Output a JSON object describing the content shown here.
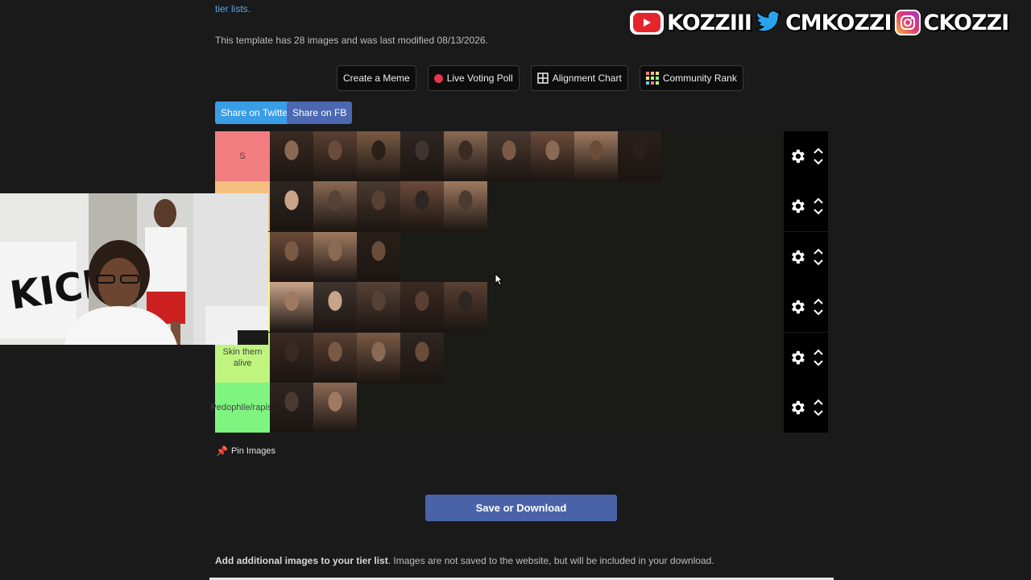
{
  "top": {
    "link": "tier lists.",
    "info": "This template has 28 images and was last modified 08/13/2026."
  },
  "social": {
    "youtube": "KOZZIII",
    "twitter": "CMKOZZI",
    "instagram": "CKOZZI"
  },
  "actions": {
    "create_meme": "Create a Meme",
    "live_poll": "Live Voting Poll",
    "alignment": "Alignment Chart",
    "community": "Community Rank"
  },
  "share": {
    "twitter": "Share on Twitter",
    "facebook": "Share on FB"
  },
  "tiers": [
    {
      "label": "S",
      "color": "#f27e81",
      "images": 9
    },
    {
      "label": "",
      "color": "#f5bf7f",
      "images": 5
    },
    {
      "label": "",
      "color": "#f5df7f",
      "images": 3
    },
    {
      "label": "",
      "color": "#f5f57f",
      "images": 5
    },
    {
      "label": "Skin them alive",
      "color": "#bff57f",
      "images": 4
    },
    {
      "label": "Pedophile/rapist",
      "color": "#7ff57f",
      "images": 2
    }
  ],
  "pin": "Pin Images",
  "save": "Save or Download",
  "add": {
    "bold": "Add additional images to your tier list",
    "rest": ". Images are not saved to the website, but will be included in your download."
  }
}
